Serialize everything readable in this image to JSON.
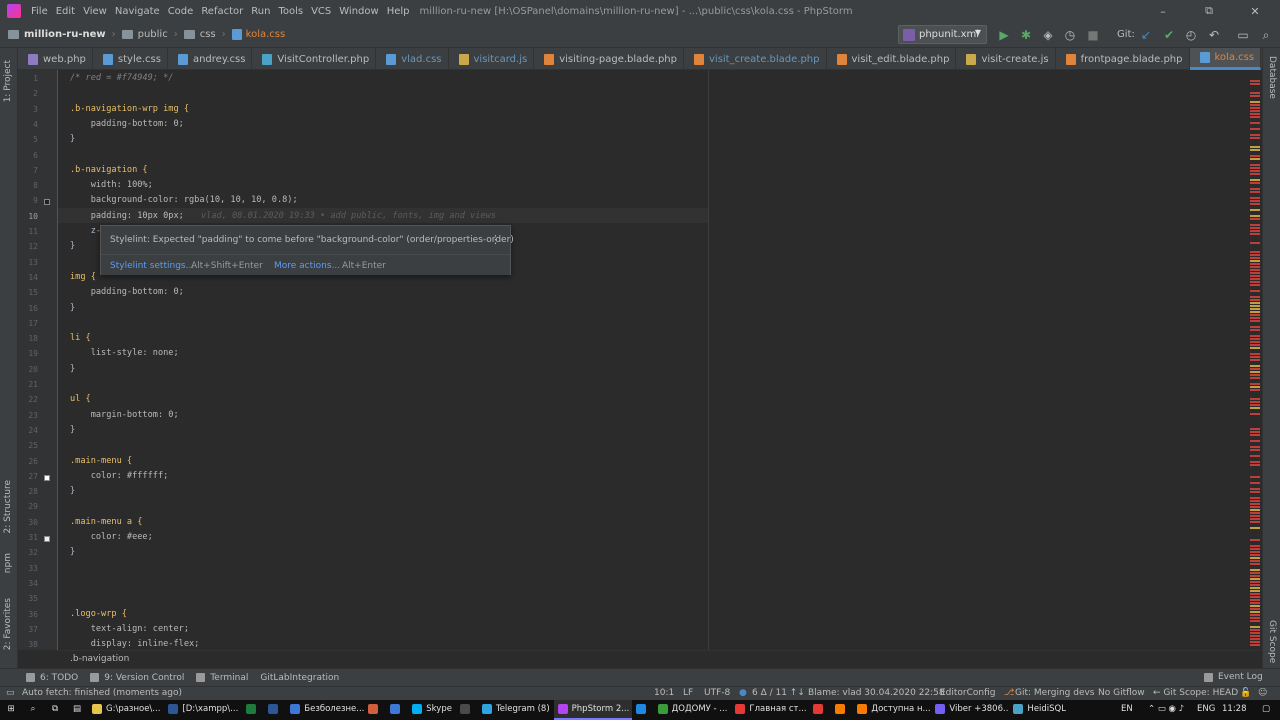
{
  "window": {
    "title": "million-ru-new [H:\\OSPanel\\domains\\million-ru-new] - ...\\public\\css\\kola.css - PhpStorm",
    "minimize": "–",
    "maximize": "⧉",
    "close": "✕"
  },
  "menu": [
    "File",
    "Edit",
    "View",
    "Navigate",
    "Code",
    "Refactor",
    "Run",
    "Tools",
    "VCS",
    "Window",
    "Help"
  ],
  "breadcrumb": [
    "million-ru-new",
    "public",
    "css",
    "kola.css"
  ],
  "run_config": "phpunit.xml",
  "git_label": "Git:",
  "tabs": [
    {
      "label": "web.php",
      "color": "#8e7cc3"
    },
    {
      "label": "style.css",
      "color": "#5a9bd5"
    },
    {
      "label": "andrey.css",
      "color": "#5a9bd5"
    },
    {
      "label": "VisitController.php",
      "color": "#4aa3c7"
    },
    {
      "label": "vlad.css",
      "color": "#5a9bd5"
    },
    {
      "label": "visitcard.js",
      "color": "#c9a94a"
    },
    {
      "label": "visiting-page.blade.php",
      "color": "#e0843c"
    },
    {
      "label": "visit_create.blade.php",
      "color": "#e0843c"
    },
    {
      "label": "visit_edit.blade.php",
      "color": "#e0843c"
    },
    {
      "label": "visit-create.js",
      "color": "#c9a94a"
    },
    {
      "label": "frontpage.blade.php",
      "color": "#e0843c"
    },
    {
      "label": "kola.css",
      "color": "#5a9bd5"
    }
  ],
  "left_tools": [
    "1: Project",
    "2: Structure",
    "npm",
    "2: Favorites"
  ],
  "right_tools": [
    "Database",
    "Git Scope"
  ],
  "lines": [
    "/* red = #f74949; */",
    "",
    ".b-navigation-wrp img {",
    "    padding-bottom: 0;",
    "}",
    "",
    ".b-navigation {",
    "    width: 100%;",
    "    background-color: rgba(10, 10, 10, 0.8);",
    "    padding: 10px 0px;",
    "    z-",
    "}",
    "",
    "img {",
    "    padding-bottom: 0;",
    "}",
    "",
    "li {",
    "    list-style: none;",
    "}",
    "",
    "ul {",
    "    margin-bottom: 0;",
    "}",
    "",
    ".main-menu {",
    "    color: #ffffff;",
    "}",
    "",
    ".main-menu a {",
    "    color: #eee;",
    "}",
    "",
    "",
    "",
    ".logo-wrp {",
    "    text-align: center;",
    "    display: inline-flex;"
  ],
  "blame_annotation": "vlad, 08.01.2020 19:33 • add public, fonts, img and views",
  "tooltip": {
    "message": "Stylelint: Expected \"padding\" to come before \"background-color\" (order/properties-order)",
    "settings_link": "Stylelint settings...",
    "settings_key": "Alt+Shift+Enter",
    "more_link": "More actions...",
    "more_key": "Alt+Enter"
  },
  "code_breadcrumb": ".b-navigation",
  "tool_windows": [
    "6: TODO",
    "9: Version Control",
    "Terminal",
    "GitLabIntegration"
  ],
  "event_log": "Event Log",
  "status": {
    "message": "Auto fetch: finished (moments ago)",
    "position": "10:1",
    "line_sep": "LF",
    "encoding": "UTF-8",
    "vcs_changes": "6 Δ / 11 ↑↓",
    "blame": "Blame: vlad 30.04.2020 22:58",
    "editorconfig": "EditorConfig",
    "git_branch": "Git: Merging devs",
    "gitflow": "No Gitflow",
    "git_scope": "← Git Scope: HEAD"
  },
  "taskbar": {
    "items": [
      {
        "label": "G:\\разное\\...",
        "color": "#e8c34a"
      },
      {
        "label": "[D:\\xampp\\...",
        "color": "#2b5797"
      },
      {
        "label": "",
        "color": "#1f7a3d"
      },
      {
        "label": "",
        "color": "#2b5797"
      },
      {
        "label": "Безболезне...",
        "color": "#3c78d8"
      },
      {
        "label": "",
        "color": "#d0603a"
      },
      {
        "label": "",
        "color": "#3c78d8"
      },
      {
        "label": "Skype",
        "color": "#00aff0"
      },
      {
        "label": "",
        "color": "#4a4a4a"
      },
      {
        "label": "Telegram (8)",
        "color": "#2ca5e0"
      },
      {
        "label": "PhpStorm 2...",
        "color": "#b345f1"
      },
      {
        "label": "",
        "color": "#1e88e5"
      },
      {
        "label": "ДОДОМУ - ...",
        "color": "#3a9b3a"
      },
      {
        "label": "Главная ст...",
        "color": "#e53935"
      },
      {
        "label": "",
        "color": "#e53935"
      },
      {
        "label": "",
        "color": "#f57c00"
      },
      {
        "label": "Доступна н...",
        "color": "#f57c00"
      },
      {
        "label": "Viber +3806...",
        "color": "#7360f2"
      },
      {
        "label": "HeidiSQL",
        "color": "#4aa3c7"
      }
    ],
    "lang_tray": "EN",
    "lang": "ENG",
    "time": "11:28"
  }
}
